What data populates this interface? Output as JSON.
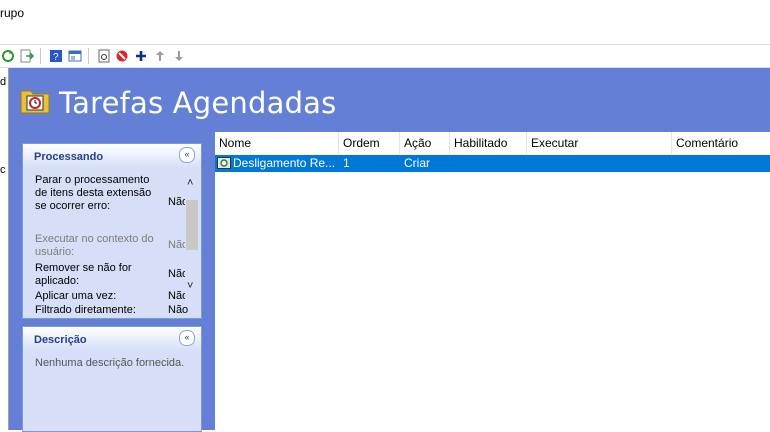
{
  "window": {
    "title": "rupo"
  },
  "toolbar": {
    "buttons": [
      {
        "icon": "refresh-icon"
      },
      {
        "icon": "export-list-icon"
      },
      {
        "icon": "help-icon"
      },
      {
        "icon": "show-hide-pane-icon"
      },
      {
        "icon": "properties-icon"
      },
      {
        "icon": "delete-icon"
      },
      {
        "icon": "new-item-icon"
      },
      {
        "icon": "move-up-icon"
      },
      {
        "icon": "move-down-icon"
      }
    ]
  },
  "left_pane": {
    "fragment_top": "d",
    "fragment_mid": "c"
  },
  "header": {
    "title": "Tarefas Agendadas",
    "icon": "scheduled-tasks-folder-icon"
  },
  "processing": {
    "label": "Processando",
    "collapse_symbol": "«",
    "properties": [
      {
        "label": "Parar o processamento de itens desta extensão se ocorrer erro:",
        "value": "Não",
        "disabled": false
      },
      {
        "label": "Executar no contexto do usuário:",
        "value": "Não",
        "disabled": true
      },
      {
        "label": "Remover se não for aplicado:",
        "value": "Não",
        "disabled": false
      },
      {
        "label": "Aplicar uma vez:",
        "value": "Não",
        "disabled": false
      },
      {
        "label": "Filtrado diretamente:",
        "value": "Não",
        "disabled": false
      }
    ],
    "scroll_up": "˄",
    "scroll_down": "˅"
  },
  "description": {
    "label": "Descrição",
    "collapse_symbol": "«",
    "text": "Nenhuma descrição fornecida."
  },
  "table": {
    "columns": [
      "Nome",
      "Ordem",
      "Ação",
      "Habilitado",
      "Executar",
      "Comentário"
    ],
    "rows": [
      {
        "nome": "Desligamento Re...",
        "ordem": "1",
        "acao": "Criar",
        "habilitado": "",
        "executar": "",
        "comentario": "",
        "selected": true
      }
    ]
  },
  "colors": {
    "accent": "#6380d6",
    "panel": "#d6dff7",
    "selection": "#0078d7"
  }
}
